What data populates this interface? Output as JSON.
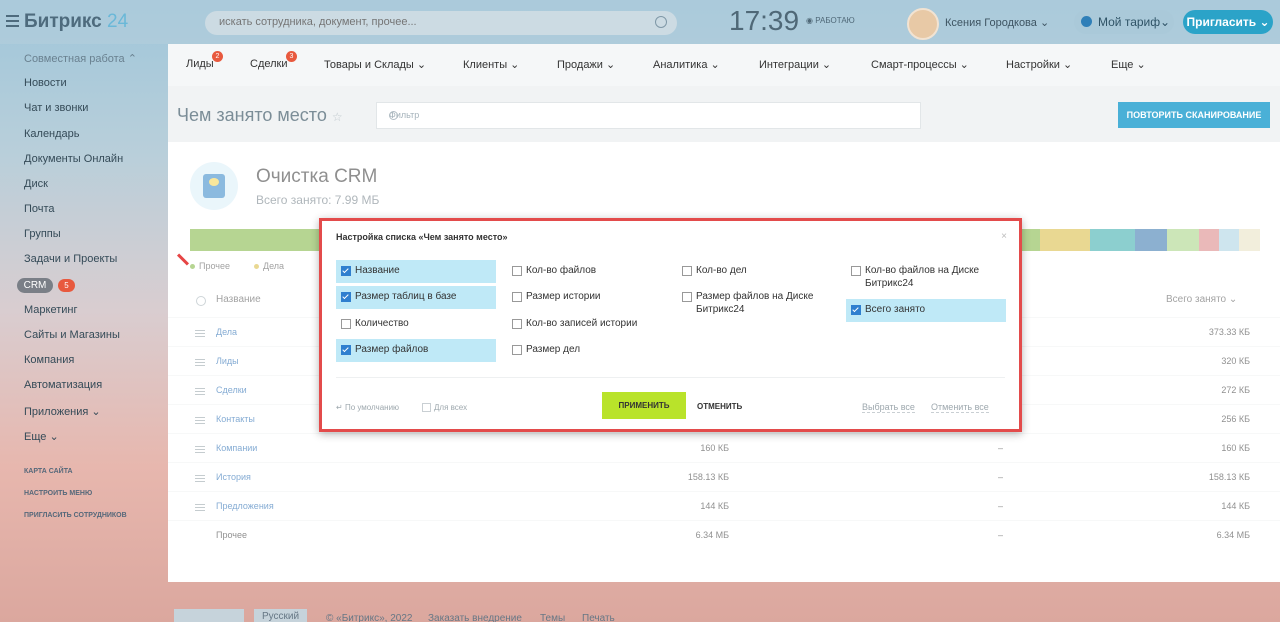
{
  "header": {
    "logo_text": "Битрикс",
    "logo_num": "24",
    "search_placeholder": "искать сотрудника, документ, прочее...",
    "clock": "17:39",
    "work_status": "РАБОТАЮ",
    "user_name": "Ксения Городкова",
    "tariff_label": "Мой тариф",
    "invite_label": "Пригласить"
  },
  "sidebar": {
    "items": [
      "Совместная работа",
      "Новости",
      "Чат и звонки",
      "Календарь",
      "Документы Онлайн",
      "Диск",
      "Почта",
      "Группы",
      "Задачи и Проекты",
      "CRM",
      "Маркетинг",
      "Сайты и Магазины",
      "Компания",
      "Автоматизация",
      "Приложения",
      "Еще"
    ],
    "crm_badge": "5",
    "small_links": [
      "КАРТА САЙТА",
      "НАСТРОИТЬ МЕНЮ",
      "ПРИГЛАСИТЬ СОТРУДНИКОВ"
    ]
  },
  "nav": {
    "items": [
      "Лиды",
      "Сделки",
      "Товары и Склады",
      "Клиенты",
      "Продажи",
      "Аналитика",
      "Интеграции",
      "Смарт-процессы",
      "Настройки",
      "Еще"
    ],
    "badge_leads": "2",
    "badge_deals": "3"
  },
  "page": {
    "title": "Чем занято место",
    "filter_placeholder": "Фильтр",
    "rescan_label": "ПОВТОРИТЬ СКАНИРОВАНИЕ",
    "crm_title": "Очистка CRM",
    "crm_total": "Всего занято: 7.99 МБ",
    "legend": [
      "Прочее",
      "Дела"
    ],
    "col_name": "Название",
    "col_total": "Всего занято",
    "bar_colors": [
      "#7bb33a",
      "#7bb33a",
      "#e6c243",
      "#2fa8a8",
      "#2f6fa9",
      "#9ad07b",
      "#d98080",
      "#a6cfe0"
    ],
    "rows": [
      {
        "name": "Дела",
        "v1": "",
        "v2": "",
        "v3": "373.33 КБ",
        "link": true
      },
      {
        "name": "Лиды",
        "v1": "",
        "v2": "",
        "v3": "320 КБ",
        "link": true
      },
      {
        "name": "Сделки",
        "v1": "",
        "v2": "",
        "v3": "272 КБ",
        "link": true
      },
      {
        "name": "Контакты",
        "v1": "",
        "v2": "",
        "v3": "256 КБ",
        "link": true
      },
      {
        "name": "Компании",
        "v1": "160 КБ",
        "v2": "–",
        "v3": "160 КБ",
        "link": true
      },
      {
        "name": "История",
        "v1": "158.13 КБ",
        "v2": "–",
        "v3": "158.13 КБ",
        "link": true
      },
      {
        "name": "Предложения",
        "v1": "144 КБ",
        "v2": "–",
        "v3": "144 КБ",
        "link": true
      },
      {
        "name": "Прочее",
        "v1": "6.34 МБ",
        "v2": "–",
        "v3": "6.34 МБ",
        "link": false
      }
    ]
  },
  "dialog": {
    "title": "Настройка списка «Чем занято место»",
    "close": "×",
    "options": [
      {
        "label": "Название",
        "checked": true
      },
      {
        "label": "Размер таблиц в базе",
        "checked": true
      },
      {
        "label": "Количество",
        "checked": false
      },
      {
        "label": "Размер файлов",
        "checked": true
      },
      {
        "label": "Кол-во файлов",
        "checked": false
      },
      {
        "label": "Размер истории",
        "checked": false
      },
      {
        "label": "Кол-во записей истории",
        "checked": false
      },
      {
        "label": "Размер дел",
        "checked": false
      },
      {
        "label": "Кол-во дел",
        "checked": false
      },
      {
        "label": "Размер файлов на Диске Битрикс24",
        "checked": false
      },
      {
        "label": "Кол-во файлов на Диске Битрикс24",
        "checked": false
      },
      {
        "label": "Всего занято",
        "checked": true
      }
    ],
    "default_label": "По умолчанию",
    "for_all_label": "Для всех",
    "apply_label": "ПРИМЕНИТЬ",
    "cancel_label": "ОТМЕНИТЬ",
    "select_all": "Выбрать все",
    "deselect_all": "Отменить все"
  },
  "footer": {
    "lang": "Русский",
    "copyright": "© «Битрикс», 2022",
    "order": "Заказать внедрение",
    "themes": "Темы",
    "print": "Печать"
  }
}
